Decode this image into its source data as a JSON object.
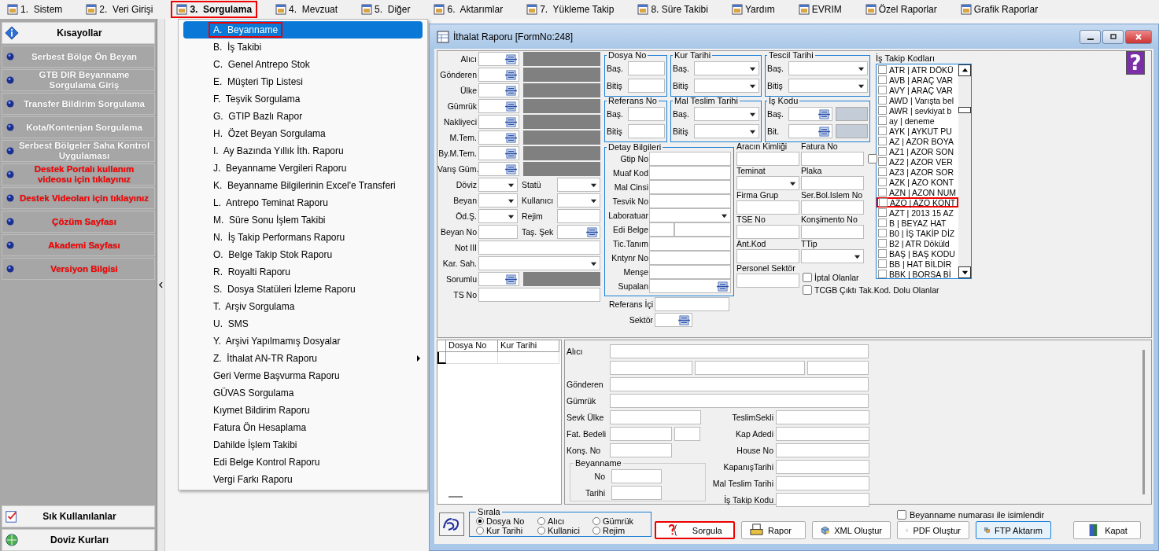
{
  "menu": [
    {
      "label": "1.  Sistem",
      "selected": false,
      "highlighted": false
    },
    {
      "label": "2.  Veri Girişi",
      "selected": false,
      "highlighted": false
    },
    {
      "label": "3.  Sorgulama",
      "selected": true,
      "highlighted": true
    },
    {
      "label": "4.  Mevzuat",
      "selected": false,
      "highlighted": false
    },
    {
      "label": "5.  Diğer",
      "selected": false,
      "highlighted": false
    },
    {
      "label": "6.  Aktarımlar",
      "selected": false,
      "highlighted": false
    },
    {
      "label": "7.  Yükleme Takip",
      "selected": false,
      "highlighted": false
    },
    {
      "label": "8. Süre Takibi",
      "selected": false,
      "highlighted": false
    },
    {
      "label": "Yardım",
      "selected": false,
      "highlighted": false
    },
    {
      "label": "EVRIM",
      "selected": false,
      "highlighted": false
    },
    {
      "label": "Özel Raporlar",
      "selected": false,
      "highlighted": false
    },
    {
      "label": "Grafik Raporlar",
      "selected": false,
      "highlighted": false
    }
  ],
  "sidebar": {
    "title": "Kısayollar",
    "items": [
      {
        "label": "Serbest Bölge Ön Beyan",
        "color": "#ffffff"
      },
      {
        "label": "GTB DIR Beyanname Sorgulama Giriş",
        "color": "#ffffff"
      },
      {
        "label": "Transfer Bildirim Sorgulama",
        "color": "#ffffff"
      },
      {
        "label": "Kota/Kontenjan Sorgulama",
        "color": "#ffffff"
      },
      {
        "label": "Serbest Bölgeler Saha Kontrol Uygulaması",
        "color": "#ffffff"
      },
      {
        "label": "Destek Portalı kullanım videosu için tıklayınız",
        "color": "#ff0000"
      },
      {
        "label": "Destek Videoları için tıklayınız",
        "color": "#ff0000"
      },
      {
        "label": "Çözüm Sayfası",
        "color": "#ff0000"
      },
      {
        "label": "Akademi Sayfası",
        "color": "#ff0000"
      },
      {
        "label": "Versiyon Bilgisi",
        "color": "#ff0000"
      }
    ],
    "sections": [
      {
        "label": "Sık Kullanılanlar",
        "kind": "favorites"
      },
      {
        "label": "Doviz Kurları",
        "kind": "currency"
      }
    ]
  },
  "dropdown": [
    {
      "label": "A.  Beyanname",
      "selected": true,
      "highlighted": true,
      "submenu": false
    },
    {
      "label": "B.  İş Takibi",
      "selected": false,
      "highlighted": false,
      "submenu": false
    },
    {
      "label": "C.  Genel Antrepo Stok",
      "selected": false,
      "highlighted": false,
      "submenu": false
    },
    {
      "label": "E.  Müşteri Tip Listesi",
      "selected": false,
      "highlighted": false,
      "submenu": false
    },
    {
      "label": "F.  Teşvik Sorgulama",
      "selected": false,
      "highlighted": false,
      "submenu": false
    },
    {
      "label": "G.  GTIP Bazlı Rapor",
      "selected": false,
      "highlighted": false,
      "submenu": false
    },
    {
      "label": "H.  Özet Beyan Sorgulama",
      "selected": false,
      "highlighted": false,
      "submenu": false
    },
    {
      "label": "I.  Ay Bazında Yıllık İth. Raporu",
      "selected": false,
      "highlighted": false,
      "submenu": false
    },
    {
      "label": "J.  Beyanname Vergileri Raporu",
      "selected": false,
      "highlighted": false,
      "submenu": false
    },
    {
      "label": "K.  Beyanname Bilgilerinin Excel'e Transferi",
      "selected": false,
      "highlighted": false,
      "submenu": false
    },
    {
      "label": "L.  Antrepo Teminat Raporu",
      "selected": false,
      "highlighted": false,
      "submenu": false
    },
    {
      "label": "M.  Süre Sonu İşlem Takibi",
      "selected": false,
      "highlighted": false,
      "submenu": false
    },
    {
      "label": "N.  İş Takip Performans Raporu",
      "selected": false,
      "highlighted": false,
      "submenu": false
    },
    {
      "label": "O.  Belge Takip Stok Raporu",
      "selected": false,
      "highlighted": false,
      "submenu": false
    },
    {
      "label": "R.  Royalti Raporu",
      "selected": false,
      "highlighted": false,
      "submenu": false
    },
    {
      "label": "S.  Dosya Statüleri İzleme Raporu",
      "selected": false,
      "highlighted": false,
      "submenu": false
    },
    {
      "label": "T.  Arşiv Sorgulama",
      "selected": false,
      "highlighted": false,
      "submenu": false
    },
    {
      "label": "U.  SMS",
      "selected": false,
      "highlighted": false,
      "submenu": false
    },
    {
      "label": "Y.  Arşivi Yapılmamış Dosyalar",
      "selected": false,
      "highlighted": false,
      "submenu": false
    },
    {
      "label": "Z.  İthalat AN-TR Raporu",
      "selected": false,
      "highlighted": false,
      "submenu": true
    },
    {
      "label": "Geri Verme Başvurma Raporu",
      "selected": false,
      "highlighted": false,
      "submenu": false
    },
    {
      "label": "GÜVAS Sorgulama",
      "selected": false,
      "highlighted": false,
      "submenu": false
    },
    {
      "label": "Kıymet Bildirim Raporu",
      "selected": false,
      "highlighted": false,
      "submenu": false
    },
    {
      "label": "Fatura Ön Hesaplama",
      "selected": false,
      "highlighted": false,
      "submenu": false
    },
    {
      "label": "Dahilde İşlem Takibi",
      "selected": false,
      "highlighted": false,
      "submenu": false
    },
    {
      "label": "Edi Belge Kontrol Raporu",
      "selected": false,
      "highlighted": false,
      "submenu": false
    },
    {
      "label": "Vergi Farkı Raporu",
      "selected": false,
      "highlighted": false,
      "submenu": false
    }
  ],
  "form": {
    "title": "İthalat Raporu [FormNo:248]",
    "help": "?",
    "left_rows": [
      {
        "kind": "lookup",
        "label": "Alıcı"
      },
      {
        "kind": "lookup",
        "label": "Gönderen"
      },
      {
        "kind": "lookup",
        "label": "Ülke"
      },
      {
        "kind": "lookup",
        "label": "Gümrük"
      },
      {
        "kind": "lookup",
        "label": "Nakliyeci"
      },
      {
        "kind": "lookup",
        "label": "M.Tem."
      },
      {
        "kind": "lookup",
        "label": "By.M.Tem."
      },
      {
        "kind": "lookup",
        "label": "Varış Güm."
      },
      {
        "kind": "pair",
        "label": "Döviz",
        "input": {
          "kind": "select"
        },
        "second": {
          "label": "Statü",
          "kind": "select"
        }
      },
      {
        "kind": "pair",
        "label": "Beyan",
        "input": {
          "kind": "select"
        },
        "second": {
          "label": "Kullanıcı",
          "kind": "select"
        }
      },
      {
        "kind": "pair",
        "label": "Öd.Ş.",
        "input": {
          "kind": "select"
        },
        "second": {
          "label": "Rejim",
          "kind": "text"
        }
      },
      {
        "kind": "pair",
        "label": "Beyan No",
        "input": {
          "kind": "text"
        },
        "second": {
          "label": "Taş. Şek",
          "kind": "lookup"
        }
      },
      {
        "kind": "text",
        "label": "Not III"
      },
      {
        "kind": "select",
        "label": "Kar. Sah."
      },
      {
        "kind": "lookup",
        "label": "Sorumlu"
      },
      {
        "kind": "text",
        "label": "TS No"
      }
    ],
    "range_groups": [
      {
        "title": "Dosya No",
        "kind": "text",
        "rows": [
          "Baş.",
          "Bitiş"
        ]
      },
      {
        "title": "Kur Tarihi",
        "kind": "select",
        "rows": [
          "Baş.",
          "Bitiş"
        ]
      },
      {
        "title": "Tescil Tarihi",
        "kind": "select",
        "rows": [
          "Baş.",
          "Bitiş"
        ]
      },
      {
        "title": "Referans No",
        "kind": "text",
        "rows": [
          "Baş.",
          "Bitiş"
        ]
      },
      {
        "title": "Mal Teslim Tarihi",
        "kind": "select",
        "rows": [
          "Baş.",
          "Bitiş"
        ]
      },
      {
        "title": "İş Kodu",
        "kind": "lookup",
        "rows": [
          "Baş.",
          "Bit."
        ]
      }
    ],
    "detail": {
      "title": "Detay Bilgileri",
      "fields": [
        {
          "label": "Gtip No",
          "kind": "text"
        },
        {
          "label": "Muaf Kod",
          "kind": "text"
        },
        {
          "label": "Mal Cinsi",
          "kind": "text"
        },
        {
          "label": "Tesvik No",
          "kind": "text"
        },
        {
          "label": "Laboratuar",
          "kind": "select"
        },
        {
          "label": "Edi Belge",
          "kind": "split"
        },
        {
          "label": "Tic.Tanım",
          "kind": "text"
        },
        {
          "label": "Kntynr No",
          "kind": "text"
        },
        {
          "label": "Menşe",
          "kind": "text"
        },
        {
          "label": "Supalan",
          "kind": "lookup"
        }
      ]
    },
    "extra_fields": [
      {
        "label": "Referans İçi",
        "kind": "text"
      },
      {
        "label": "Sektör",
        "kind": "lookup"
      }
    ],
    "right_fields": [
      {
        "label": "Aracın Kimliği",
        "kind": "text"
      },
      {
        "label": "Fatura No",
        "kind": "text_check",
        "checked": false
      },
      {
        "label": "Teminat",
        "kind": "select"
      },
      {
        "label": "Plaka",
        "kind": "text"
      },
      {
        "label": "Firma Grup",
        "kind": "text"
      },
      {
        "label": "Ser.Bol.Islem No",
        "kind": "text"
      },
      {
        "label": "TSE No",
        "kind": "text"
      },
      {
        "label": "Konşimento No",
        "kind": "text"
      },
      {
        "label": "Ant.Kod",
        "kind": "text"
      },
      {
        "label": "TTip",
        "kind": "select"
      },
      {
        "label": "Personel Sektör",
        "kind": "text"
      }
    ],
    "options": [
      {
        "label": "İptal Olanlar",
        "checked": false
      },
      {
        "label": "TCGB Çıktı Tak.Kod. Dolu Olanlar",
        "checked": false
      }
    ],
    "codes": {
      "title": "İş Takip Kodları",
      "items": [
        {
          "label": "ATR | ATR DÖKÜ",
          "checked": false,
          "highlighted": false
        },
        {
          "label": "AVB | ARAÇ VAR",
          "checked": false,
          "highlighted": false
        },
        {
          "label": "AVY | ARAÇ VAR",
          "checked": false,
          "highlighted": false
        },
        {
          "label": "AWD | Varışta bel",
          "checked": false,
          "highlighted": false
        },
        {
          "label": "AWR | sevkiyat b",
          "checked": false,
          "highlighted": false
        },
        {
          "label": "ay | deneme",
          "checked": false,
          "highlighted": false
        },
        {
          "label": "AYK | AYKUT PU",
          "checked": false,
          "highlighted": false
        },
        {
          "label": "AZ | AZOR BOYA",
          "checked": false,
          "highlighted": false
        },
        {
          "label": "AZ1 | AZOR SON",
          "checked": false,
          "highlighted": false
        },
        {
          "label": "AZ2 | AZOR VER",
          "checked": false,
          "highlighted": false
        },
        {
          "label": "AZ3 | AZOR SOR",
          "checked": false,
          "highlighted": false
        },
        {
          "label": "AZK | AZO KONT",
          "checked": false,
          "highlighted": false
        },
        {
          "label": "AZN | AZON NUM",
          "checked": false,
          "highlighted": false
        },
        {
          "label": "AZO | AZO KONT",
          "checked": false,
          "highlighted": true
        },
        {
          "label": "AZT | 2013 15 AZ",
          "checked": false,
          "highlighted": false
        },
        {
          "label": "B | BEYAZ HAT",
          "checked": false,
          "highlighted": false
        },
        {
          "label": "B0 | İŞ TAKİP DİZ",
          "checked": false,
          "highlighted": false
        },
        {
          "label": "B2 | ATR Döküld",
          "checked": false,
          "highlighted": false
        },
        {
          "label": "BAŞ | BAŞ KODU",
          "checked": false,
          "highlighted": false
        },
        {
          "label": "BB | HAT BİLDİR",
          "checked": false,
          "highlighted": false
        },
        {
          "label": "BBK | BORSA Bİ",
          "checked": false,
          "highlighted": false
        }
      ]
    },
    "grid_columns": [
      "Dosya No",
      "Kur Tarihi"
    ],
    "summary": {
      "wide": [
        "Alıcı",
        "Gönderen",
        "Gümrük"
      ],
      "left": [
        {
          "label": "Sevk Ülke",
          "kind": "text"
        },
        {
          "label": "Fat. Bedeli",
          "kind": "pair"
        },
        {
          "label": "Konş. No",
          "kind": "short"
        }
      ],
      "group": {
        "title": "Beyanname",
        "rows": [
          "No",
          "Tarihi"
        ]
      },
      "right": [
        "TeslimSekli",
        "Kap Adedi",
        "House No",
        "KapanışTarihi",
        "Mal Teslim Tarihi",
        "İş Takip Kodu"
      ]
    },
    "sort": {
      "title": "Sırala",
      "options": [
        {
          "label": "Dosya No",
          "selected": true
        },
        {
          "label": "Alıcı",
          "selected": false
        },
        {
          "label": "Gümrük",
          "selected": false
        },
        {
          "label": "Kur Tarihi",
          "selected": false
        },
        {
          "label": "Kullanici",
          "selected": false
        },
        {
          "label": "Rejim",
          "selected": false
        }
      ]
    },
    "name_option": {
      "label": "Beyanname numarası ile isimlendir",
      "checked": false
    },
    "buttons": [
      {
        "label": "Sorgula",
        "kind": "query",
        "highlighted": true,
        "focused": false
      },
      {
        "label": "Rapor",
        "kind": "report",
        "highlighted": false,
        "focused": false
      },
      {
        "label": "XML Oluştur",
        "kind": "xml",
        "highlighted": false,
        "focused": false
      },
      {
        "label": "PDF Oluştur",
        "kind": "pdf",
        "highlighted": false,
        "focused": false
      },
      {
        "label": "FTP Aktarım",
        "kind": "ftp",
        "highlighted": false,
        "focused": true
      },
      {
        "label": "Kapat",
        "kind": "close",
        "highlighted": false,
        "focused": false
      }
    ]
  }
}
